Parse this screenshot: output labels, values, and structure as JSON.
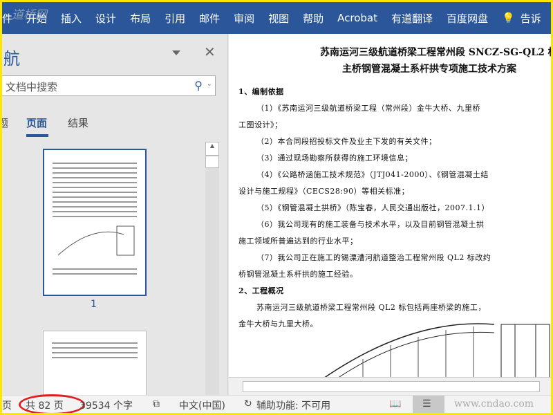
{
  "ribbon": {
    "watermark": "道桥网",
    "tabs": [
      "件",
      "开始",
      "插入",
      "设计",
      "布局",
      "引用",
      "邮件",
      "审阅",
      "视图",
      "帮助",
      "Acrobat",
      "有道翻译",
      "百度网盘"
    ],
    "tell_me": "告诉"
  },
  "nav": {
    "title": "航",
    "search_placeholder": "文档中搜索",
    "tabs": [
      "题",
      "页面",
      "结果"
    ],
    "active_tab": "页面",
    "page_label": "1"
  },
  "document": {
    "title1": "苏南运河三级航道桥梁工程常州段 SNCZ-SG-QL2 标",
    "title2": "主桥钢管混凝土系杆拱专项施工技术方案",
    "lines": [
      {
        "text": "1、编制依据",
        "bold": true,
        "indent": false
      },
      {
        "text": "（1）《苏南运河三级航道桥梁工程（常州段）金牛大桥、九里桥",
        "bold": false,
        "indent": true
      },
      {
        "text": "工图设计》；",
        "bold": false,
        "indent": false
      },
      {
        "text": "（2）本合同段招投标文件及业主下发的有关文件；",
        "bold": false,
        "indent": true
      },
      {
        "text": "（3）通过现场勘察所获得的施工环境信息；",
        "bold": false,
        "indent": true
      },
      {
        "text": "（4）《公路桥涵施工技术规范》（JTJ041-2000）、《钢管混凝土结",
        "bold": false,
        "indent": true
      },
      {
        "text": "设计与施工规程》（CECS28:90）等相关标准；",
        "bold": false,
        "indent": false
      },
      {
        "text": "（5）《钢管混凝土拱桥》（陈宝春，人民交通出版社，2007.1.1）",
        "bold": false,
        "indent": true
      },
      {
        "text": "（6）我公司现有的施工装备与技术水平，以及目前钢管混凝土拱",
        "bold": false,
        "indent": true
      },
      {
        "text": "施工领域所普遍达到的行业水平；",
        "bold": false,
        "indent": false
      },
      {
        "text": "（7）我公司正在施工的锡溧漕河航道整治工程常州段 QL2 标改约",
        "bold": false,
        "indent": true
      },
      {
        "text": "桥钢管混凝土系杆拱的施工经验。",
        "bold": false,
        "indent": false
      },
      {
        "text": "2、工程概况",
        "bold": true,
        "indent": false
      },
      {
        "text": "苏南运河三级航道桥梁工程常州段 QL2 标包括两座桥梁的施工，",
        "bold": false,
        "indent": true
      },
      {
        "text": "金牛大桥与九里大桥。",
        "bold": false,
        "indent": false
      }
    ]
  },
  "status": {
    "page_prefix": "页",
    "page_count": "共 82 页",
    "word_count": "39534 个字",
    "language": "中文(中国)",
    "accessibility": "辅助功能: 不可用",
    "watermark": "www.cndao.com",
    "highlight_color": "#e02020"
  },
  "colors": {
    "ribbon": "#2b579a",
    "border": "#ffe600"
  }
}
